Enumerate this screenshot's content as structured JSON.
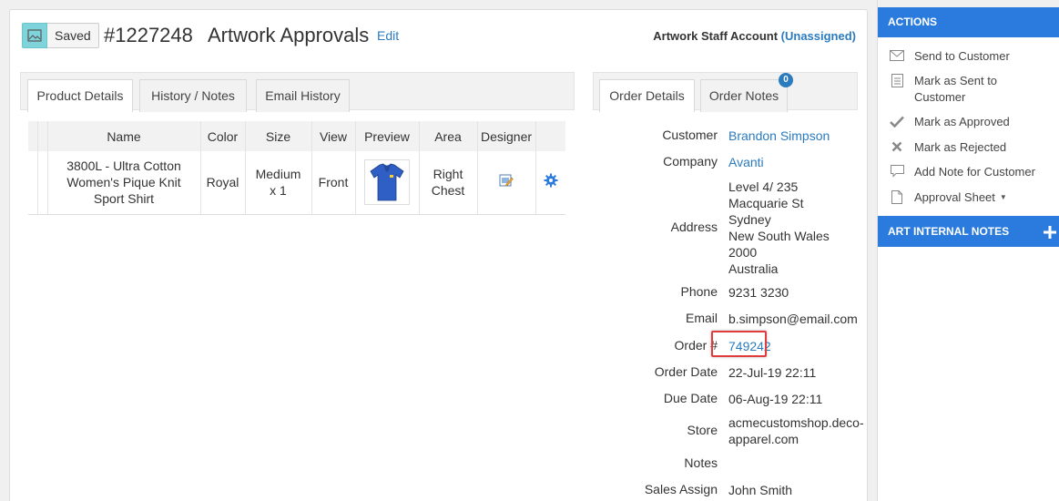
{
  "header": {
    "saved_label": "Saved",
    "order_id": "#1227248",
    "title": "Artwork Approvals",
    "edit_label": "Edit",
    "staff_label": "Artwork Staff Account",
    "staff_value": "(Unassigned)"
  },
  "left_tabs": [
    "Product Details",
    "History / Notes",
    "Email History"
  ],
  "right_tabs": {
    "order_details": "Order Details",
    "order_notes": "Order Notes",
    "order_notes_count": "0"
  },
  "table": {
    "headers": [
      "Name",
      "Color",
      "Size",
      "View",
      "Preview",
      "Area",
      "Designer"
    ],
    "row": {
      "name": [
        "3800L - Ultra Cotton",
        "Women's Pique Knit",
        "Sport Shirt"
      ],
      "color": "Royal",
      "size": [
        "Medium",
        "x 1"
      ],
      "view": "Front",
      "area": [
        "Right",
        "Chest"
      ]
    }
  },
  "order_details": {
    "customer_label": "Customer",
    "customer": "Brandon Simpson",
    "company_label": "Company",
    "company": "Avanti",
    "address_label": "Address",
    "address": [
      "Level 4/ 235",
      "Macquarie St",
      "Sydney",
      "New South Wales",
      "2000",
      "Australia"
    ],
    "phone_label": "Phone",
    "phone": "9231 3230",
    "email_label": "Email",
    "email": "b.simpson@email.com",
    "order_label": "Order #",
    "order_number": "749242",
    "order_date_label": "Order Date",
    "order_date": "22-Jul-19 22:11",
    "due_date_label": "Due Date",
    "due_date": "06-Aug-19 22:11",
    "store_label": "Store",
    "store": [
      "acmecustomshop.deco-",
      "apparel.com"
    ],
    "notes_label": "Notes",
    "sales_label": "Sales Assign",
    "sales": "John Smith"
  },
  "sidebar": {
    "actions_title": "ACTIONS",
    "items": [
      {
        "label": "Send to Customer",
        "icon": "envelope-icon"
      },
      {
        "label": "Mark as Sent to",
        "label2": "Customer",
        "icon": "document-icon"
      },
      {
        "label": "Mark as Approved",
        "icon": "checkmark-icon"
      },
      {
        "label": "Mark as Rejected",
        "icon": "x-icon"
      },
      {
        "label": "Add Note for Customer",
        "icon": "comment-icon"
      },
      {
        "label": "Approval Sheet",
        "icon": "file-icon"
      }
    ],
    "notes_title": "ART INTERNAL NOTES"
  },
  "colors": {
    "accent": "#2b7bdf",
    "link": "#2b7bbf",
    "highlight": "#e03c3c"
  }
}
